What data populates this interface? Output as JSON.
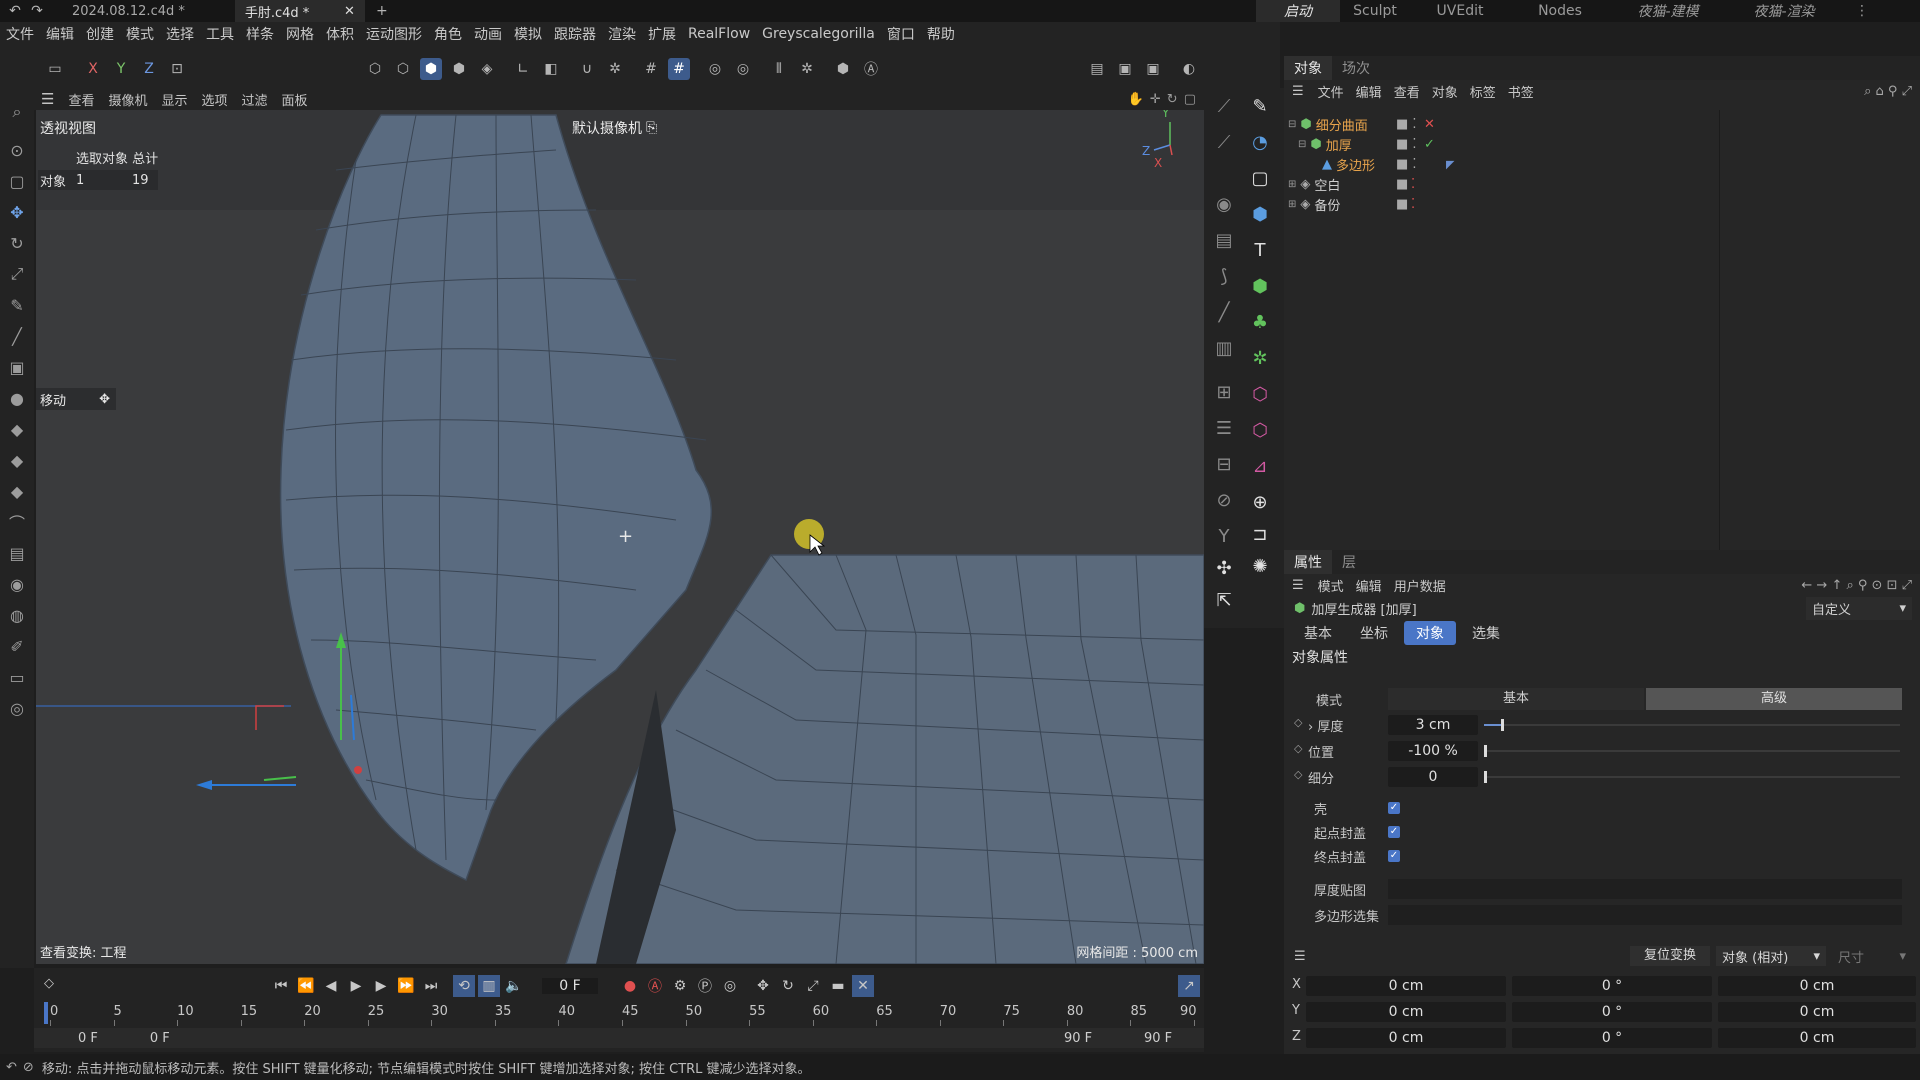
{
  "titlebar": {
    "tabs": [
      {
        "label": "2024.08.12.c4d *",
        "active": false
      },
      {
        "label": "手肘.c4d *",
        "active": true
      }
    ],
    "layouts": [
      {
        "label": "启动",
        "active": true
      },
      {
        "label": "Sculpt",
        "active": false
      },
      {
        "label": "UVEdit",
        "active": false
      },
      {
        "label": "Nodes",
        "active": false
      },
      {
        "label": "夜猫-建模",
        "active": false
      },
      {
        "label": "夜猫-渲染",
        "active": false
      }
    ]
  },
  "menubar": [
    "文件",
    "编辑",
    "创建",
    "模式",
    "选择",
    "工具",
    "样条",
    "网格",
    "体积",
    "运动图形",
    "角色",
    "动画",
    "模拟",
    "跟踪器",
    "渲染",
    "扩展",
    "RealFlow",
    "Greyscalegorilla",
    "窗口",
    "帮助"
  ],
  "toolbar": {
    "axes": [
      "X",
      "Y",
      "Z"
    ]
  },
  "viewport_menu": [
    "查看",
    "摄像机",
    "显示",
    "选项",
    "过滤",
    "面板"
  ],
  "viewport": {
    "title": "透视视图",
    "camera": "默认摄像机",
    "hud_header": "选取对象 总计",
    "hud_label": "对象",
    "hud_selected": "1",
    "hud_total": "19",
    "tool_label": "移动",
    "transform_label": "查看变换: 工程",
    "grid_spacing": "网格间距 : 5000 cm",
    "axis_y": "Y",
    "axis_z": "Z",
    "axis_x": "X"
  },
  "object_manager": {
    "tabs": [
      {
        "label": "对象",
        "active": true
      },
      {
        "label": "场次",
        "active": false
      }
    ],
    "menu": [
      "文件",
      "编辑",
      "查看",
      "对象",
      "标签",
      "书签"
    ],
    "objects": [
      {
        "name": "细分曲面",
        "color": "#e8a44c"
      },
      {
        "name": "加厚",
        "color": "#e8a44c"
      },
      {
        "name": "多边形",
        "color": "#e8a44c"
      },
      {
        "name": "空白",
        "color": "#cfcfcf"
      },
      {
        "name": "备份",
        "color": "#cfcfcf"
      }
    ]
  },
  "attributes": {
    "tabs": [
      {
        "label": "属性",
        "active": true
      },
      {
        "label": "层",
        "active": false
      }
    ],
    "menu": [
      "模式",
      "编辑",
      "用户数据"
    ],
    "object_title": "加厚生成器 [加厚]",
    "preset": "自定义",
    "subtabs": [
      {
        "label": "基本",
        "active": false
      },
      {
        "label": "坐标",
        "active": false
      },
      {
        "label": "对象",
        "active": true
      },
      {
        "label": "选集",
        "active": false
      }
    ],
    "section": "对象属性",
    "mode_label": "模式",
    "mode_options": [
      "基本",
      "高级"
    ],
    "thickness_label": "› 厚度",
    "thickness_value": "3 cm",
    "thickness_fraction": 0.04,
    "position_label": "位置",
    "position_value": "-100 %",
    "subdivision_label": "细分",
    "subdivision_value": "0",
    "shell_label": "壳",
    "start_cap_label": "起点封盖",
    "end_cap_label": "终点封盖",
    "thickness_map_label": "厚度贴图",
    "polygon_selection_label": "多边形选集"
  },
  "coordinates": {
    "reset_button": "复位变换",
    "mode": "对象 (相对)",
    "size_label": "尺寸",
    "rows": [
      {
        "axis": "X",
        "pos": "0 cm",
        "rot": "0 °",
        "size": "0 cm"
      },
      {
        "axis": "Y",
        "pos": "0 cm",
        "rot": "0 °",
        "size": "0 cm"
      },
      {
        "axis": "Z",
        "pos": "0 cm",
        "rot": "0 °",
        "size": "0 cm"
      }
    ]
  },
  "timeline": {
    "current_frame": "0 F",
    "ruler": [
      "0",
      "5",
      "10",
      "15",
      "20",
      "25",
      "30",
      "35",
      "40",
      "45",
      "50",
      "55",
      "60",
      "65",
      "70",
      "75",
      "80",
      "85",
      "90"
    ],
    "start": "0 F",
    "preview_start": "0 F",
    "preview_end": "90 F",
    "end": "90 F"
  },
  "status": {
    "text": "移动: 点击并拖动鼠标移动元素。按住 SHIFT 键量化移动; 节点编辑模式时按住 SHIFT 键增加选择对象; 按住 CTRL 键减少选择对象。"
  },
  "colors": {
    "accent": "#4a76c7",
    "selected_tab": "#4a76c7",
    "viewport_bg": "#3a3b3d",
    "mesh": "#5a6b80"
  }
}
